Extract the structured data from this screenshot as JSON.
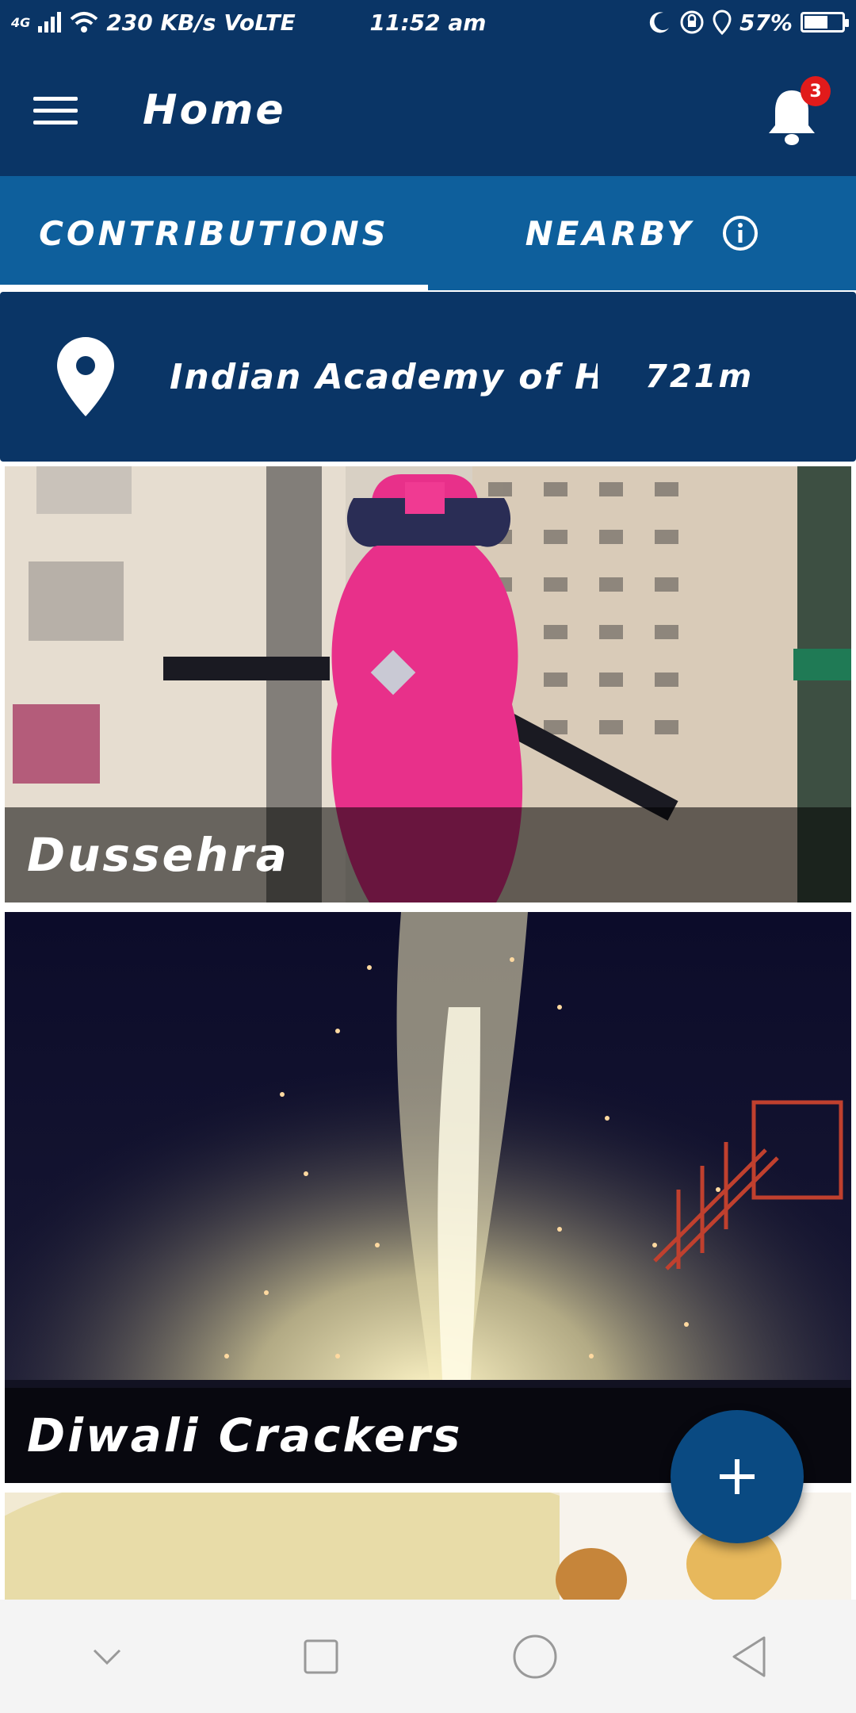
{
  "status_bar": {
    "network": "4G",
    "speed": "230 KB/s",
    "volte": "VoLTE",
    "time": "11:52 am",
    "battery": "57%",
    "battery_level": 0.57
  },
  "app_bar": {
    "title": "Home",
    "notification_count": "3"
  },
  "tabs": [
    {
      "label": "CONTRIBUTIONS",
      "active": true
    },
    {
      "label": "NEARBY",
      "active": false
    }
  ],
  "location": {
    "name": "Indian Academy of Hig...",
    "distance": "721m"
  },
  "feed": [
    {
      "caption": "Dussehra"
    },
    {
      "caption": "Diwali Crackers"
    },
    {
      "caption": ""
    }
  ],
  "colors": {
    "primary_dark": "#0a3566",
    "tab_bar": "#0e5f9c",
    "fab": "#0a4a82",
    "badge": "#e11b1b"
  },
  "icons": {
    "menu": "menu-icon",
    "notifications": "bell-icon",
    "info": "info-icon",
    "location": "location-pin-icon",
    "fab": "plus-icon",
    "nav": [
      "chevron-down-icon",
      "square-icon",
      "circle-icon",
      "back-triangle-icon"
    ]
  }
}
